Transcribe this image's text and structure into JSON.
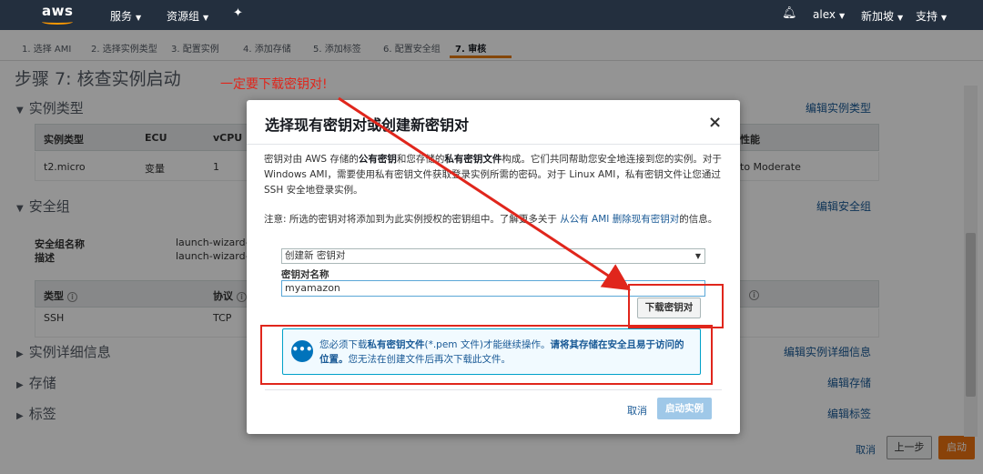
{
  "topnav": {
    "logo": "aws",
    "services": "服务",
    "resource_groups": "资源组",
    "user": "alex",
    "region": "新加坡",
    "support": "支持"
  },
  "tabs": [
    "1. 选择 AMI",
    "2. 选择实例类型",
    "3. 配置实例",
    "4. 添加存储",
    "5. 添加标签",
    "6. 配置安全组",
    "7. 审核"
  ],
  "page_title": "步骤 7: 核查实例启动",
  "instance_type": {
    "title": "实例类型",
    "edit": "编辑实例类型",
    "headers": [
      "实例类型",
      "ECU",
      "vCPU",
      "性能"
    ],
    "row": [
      "t2.micro",
      "变量",
      "1",
      "to Moderate"
    ]
  },
  "security_group": {
    "title": "安全组",
    "edit": "编辑安全组",
    "name_label": "安全组名称",
    "name_value": "launch-wizard-1",
    "desc_label": "描述",
    "desc_value": "launch-wizard-1",
    "headers": [
      "类型",
      "协议"
    ],
    "row": [
      "SSH",
      "TCP"
    ]
  },
  "instance_details": {
    "title": "实例详细信息",
    "edit": "编辑实例详细信息"
  },
  "storage": {
    "title": "存储",
    "edit": "编辑存储"
  },
  "tags": {
    "title": "标签",
    "edit": "编辑标签"
  },
  "bottom": {
    "cancel": "取消",
    "prev": "上一步",
    "launch": "启动"
  },
  "modal": {
    "title": "选择现有密钥对或创建新密钥对",
    "close": "×",
    "para1_a": "密钥对由 AWS 存储的",
    "para1_b": "公有密钥",
    "para1_c": "和您存储的",
    "para1_d": "私有密钥文件",
    "para1_e": "构成。它们共同帮助您安全地连接到您的实例。对于 Windows AMI，需要使用私有密钥文件获取登录实例所需的密码。对于 Linux AMI，私有密钥文件让您通过 SSH 安全地登录实例。",
    "para2_a": "注意: 所选的密钥对将添加到为此实例授权的密钥组中。了解更多关于 ",
    "para2_link": "从公有 AMI 删除现有密钥对",
    "para2_b": "的信息。",
    "select_value": "创建新 密钥对",
    "field_label": "密钥对名称",
    "field_value": "myamazon",
    "download_button": "下载密钥对",
    "alert_a": "您必须下载",
    "alert_b": "私有密钥文件",
    "alert_c": "(*.pem 文件)才能继续操作。",
    "alert_d": "请将其存储在安全且易于访问的位置。",
    "alert_e": "您无法在创建文件后再次下载此文件。",
    "cancel": "取消",
    "launch": "启动实例"
  },
  "annotation": {
    "text": "一定要下载密钥对!",
    "color": "#e0261c"
  }
}
